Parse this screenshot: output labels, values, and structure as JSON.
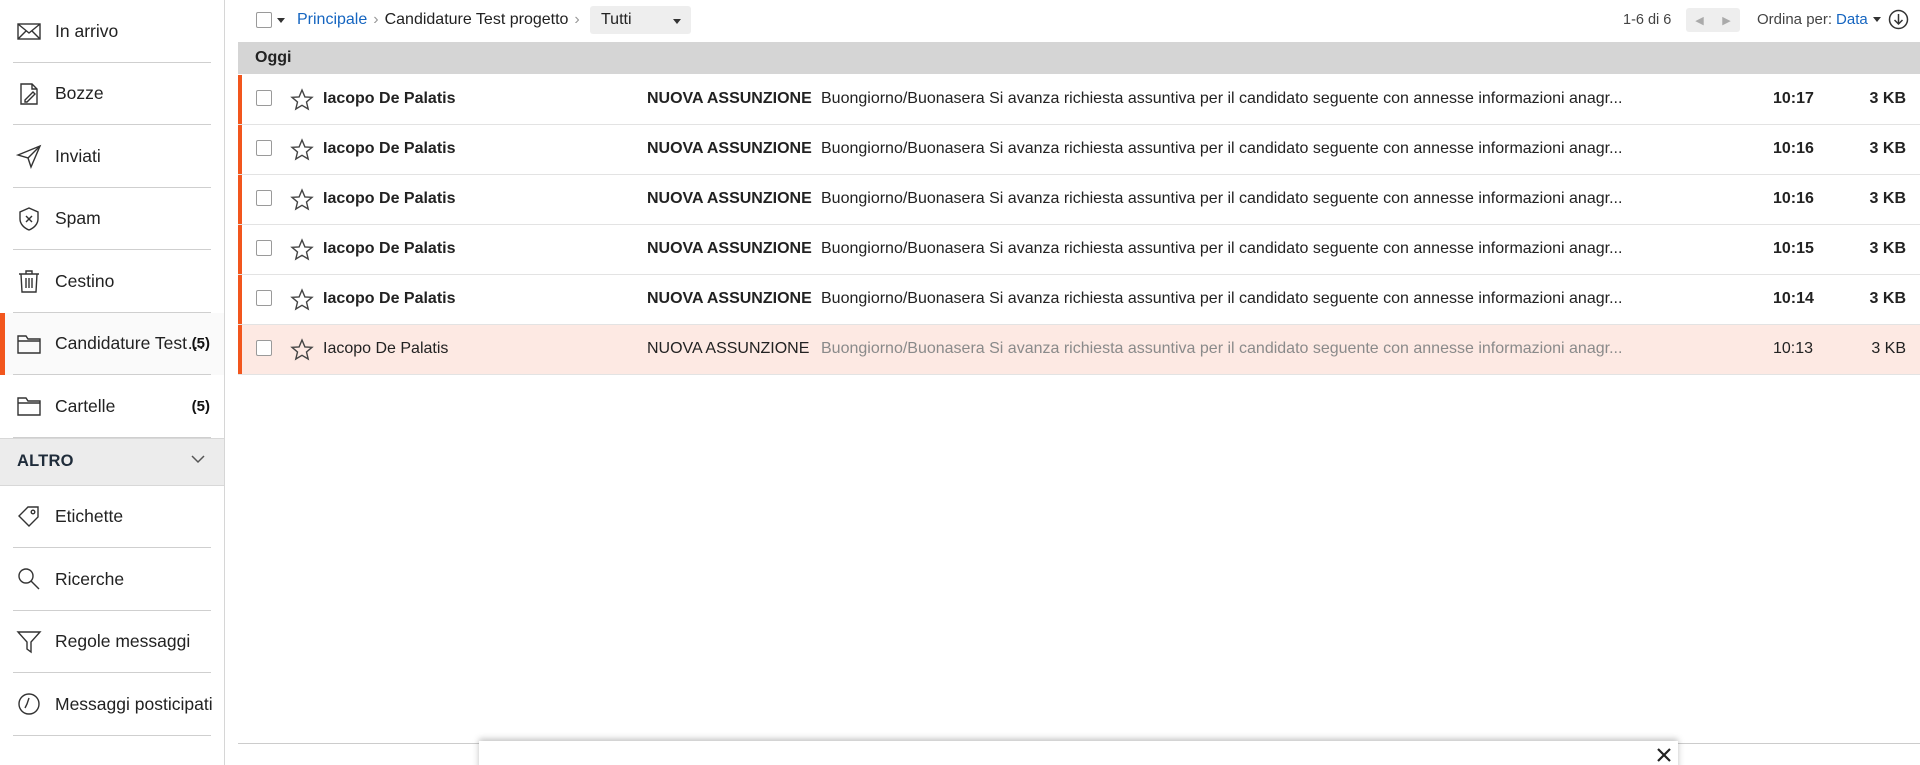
{
  "sidebar": {
    "items": [
      {
        "label": "In arrivo",
        "icon": "envelope-icon"
      },
      {
        "label": "Bozze",
        "icon": "draft-icon"
      },
      {
        "label": "Inviati",
        "icon": "send-icon"
      },
      {
        "label": "Spam",
        "icon": "shield-icon"
      },
      {
        "label": "Cestino",
        "icon": "trash-icon"
      },
      {
        "label": "Candidature Test progetto",
        "count": "(5)",
        "icon": "folder-icon"
      },
      {
        "label": "Cartelle",
        "count": "(5)",
        "icon": "folder-icon"
      }
    ],
    "section_title": "ALTRO",
    "extra_items": [
      {
        "label": "Etichette",
        "icon": "tag-icon"
      },
      {
        "label": "Ricerche",
        "icon": "search-icon"
      },
      {
        "label": "Regole messaggi",
        "icon": "filter-icon"
      },
      {
        "label": "Messaggi posticipati",
        "icon": "clock-icon"
      }
    ]
  },
  "toolbar": {
    "breadcrumb_root": "Principale",
    "breadcrumb_current": "Candidature Test progetto",
    "filter_value": "Tutti",
    "paging_text": "1-6 di 6",
    "prev_page": "◀",
    "next_page": "▶",
    "sort_label": "Ordina per:",
    "sort_value": "Data"
  },
  "list": {
    "group_label": "Oggi",
    "messages": [
      {
        "from": "Iacopo De Palatis",
        "subject": "NUOVA ASSUNZIONE",
        "preview": "Buongiorno/Buonasera Si avanza richiesta assuntiva per il candidato seguente con annesse informazioni anagr...",
        "time": "10:17",
        "size": "3 KB",
        "unread": true
      },
      {
        "from": "Iacopo De Palatis",
        "subject": "NUOVA ASSUNZIONE",
        "preview": "Buongiorno/Buonasera Si avanza richiesta assuntiva per il candidato seguente con annesse informazioni anagr...",
        "time": "10:16",
        "size": "3 KB",
        "unread": true
      },
      {
        "from": "Iacopo De Palatis",
        "subject": "NUOVA ASSUNZIONE",
        "preview": "Buongiorno/Buonasera Si avanza richiesta assuntiva per il candidato seguente con annesse informazioni anagr...",
        "time": "10:16",
        "size": "3 KB",
        "unread": true
      },
      {
        "from": "Iacopo De Palatis",
        "subject": "NUOVA ASSUNZIONE",
        "preview": "Buongiorno/Buonasera Si avanza richiesta assuntiva per il candidato seguente con annesse informazioni anagr...",
        "time": "10:15",
        "size": "3 KB",
        "unread": true
      },
      {
        "from": "Iacopo De Palatis",
        "subject": "NUOVA ASSUNZIONE",
        "preview": "Buongiorno/Buonasera Si avanza richiesta assuntiva per il candidato seguente con annesse informazioni anagr...",
        "time": "10:14",
        "size": "3 KB",
        "unread": true
      },
      {
        "from": "Iacopo De Palatis",
        "subject": "NUOVA ASSUNZIONE",
        "preview": "Buongiorno/Buonasera Si avanza richiesta assuntiva per il candidato seguente con annesse informazioni anagr...",
        "time": "10:13",
        "size": "3 KB",
        "unread": false,
        "selected": true
      }
    ]
  },
  "colors": {
    "accent": "#f2561d",
    "link": "#1565c0",
    "selected_row": "#fde9e3"
  }
}
